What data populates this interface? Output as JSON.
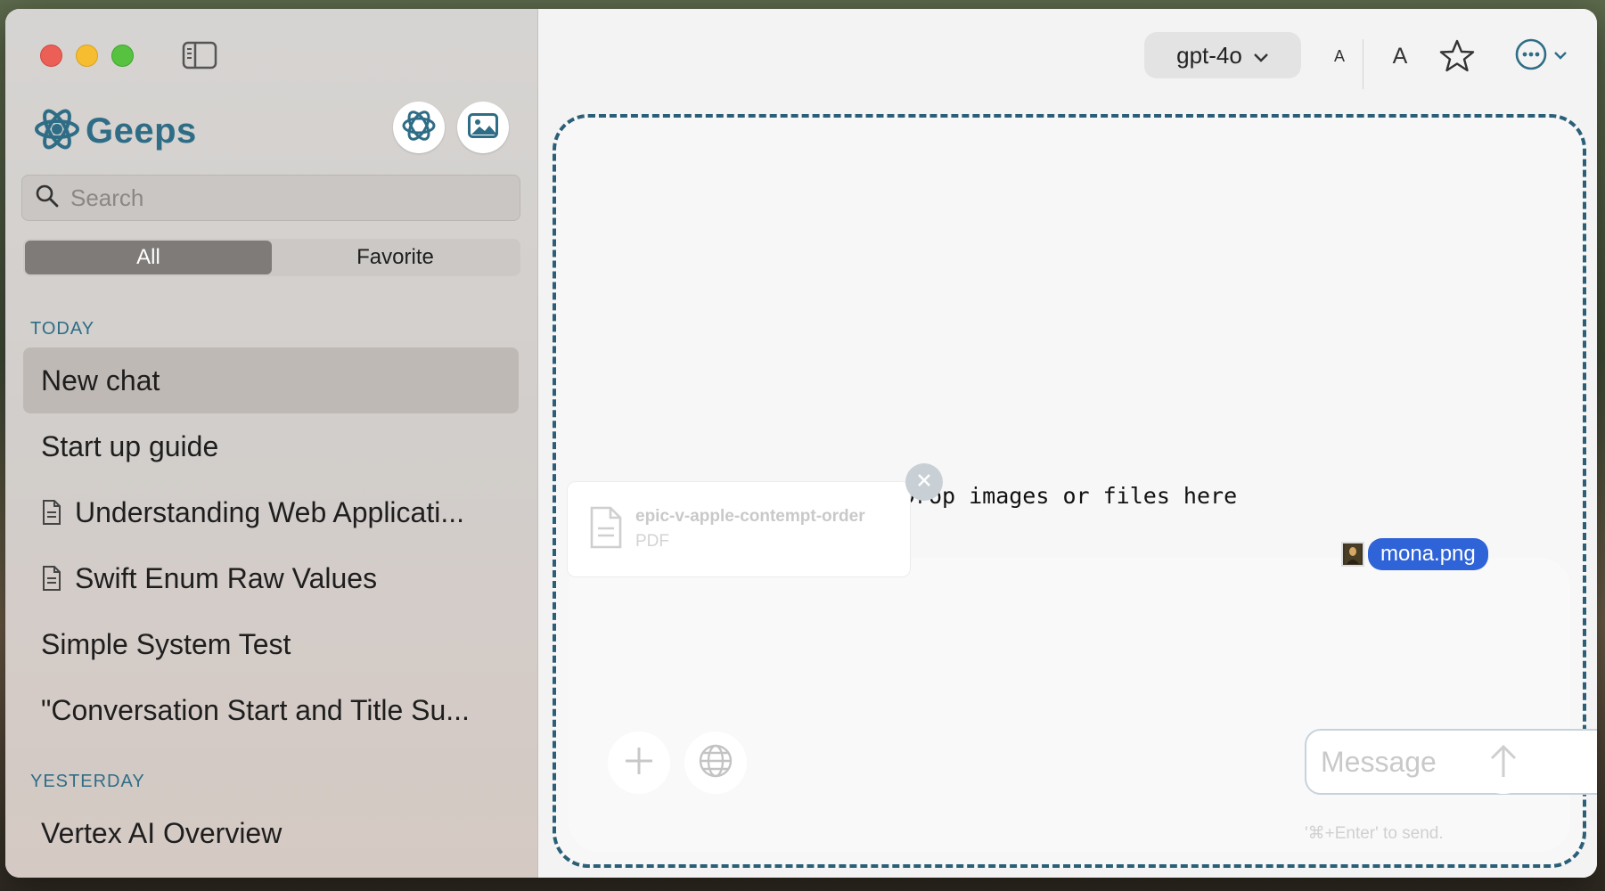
{
  "app": {
    "name": "Geeps"
  },
  "sidebar": {
    "search_placeholder": "Search",
    "filter": {
      "options": [
        "All",
        "Favorite"
      ],
      "selected": "All"
    },
    "sections": [
      {
        "label": "TODAY",
        "items": [
          {
            "title": "New chat",
            "icon": null,
            "selected": true
          },
          {
            "title": "Start up guide",
            "icon": null,
            "selected": false
          },
          {
            "title": "Understanding Web Applicati...",
            "icon": "document-icon",
            "selected": false
          },
          {
            "title": "Swift Enum Raw Values",
            "icon": "document-icon",
            "selected": false
          },
          {
            "title": "Simple System Test",
            "icon": null,
            "selected": false
          },
          {
            "title": "\"Conversation Start and Title Su...",
            "icon": null,
            "selected": false
          }
        ]
      },
      {
        "label": "YESTERDAY",
        "items": [
          {
            "title": "Vertex AI Overview",
            "icon": null,
            "selected": false
          }
        ]
      }
    ]
  },
  "toolbar": {
    "model": "gpt-4o",
    "font_smaller_label": "A",
    "font_larger_label": "A"
  },
  "main": {
    "drop_text": "Drop images or files here",
    "attachment": {
      "name": "epic-v-apple-contempt-order",
      "type": "PDF"
    },
    "drag_file": "mona.png",
    "message_placeholder": "Message",
    "send_hint": "'⌘+Enter' to send."
  },
  "colors": {
    "brand": "#2f6d86",
    "drop_border": "#2b5f78",
    "drag_chip": "#2f63d8",
    "sidebar_selected": "#bfb9b5"
  }
}
